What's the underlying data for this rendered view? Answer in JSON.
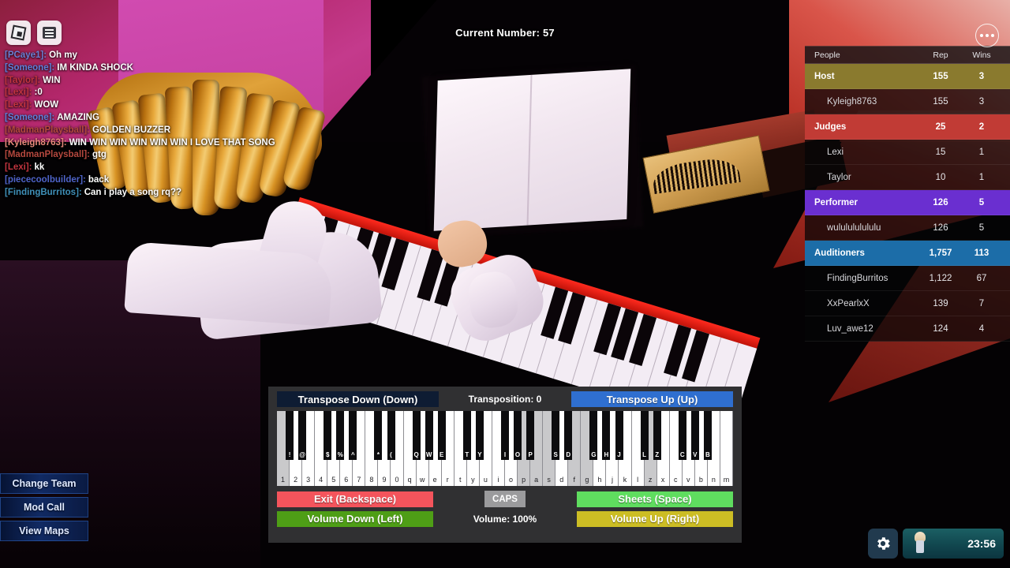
{
  "hud": {
    "roblox_icon": "roblox-logo-icon",
    "chat_icon": "chat-icon",
    "menu_icon": "more-options-icon",
    "current_number_label": "Current Number: 57"
  },
  "chat": {
    "lines": [
      {
        "name": "[PCaye1]:",
        "msg": "Oh my",
        "color": "#6a7fd4"
      },
      {
        "name": "[Someone]:",
        "msg": "IM KINDA SHOCK",
        "color": "#5f7fd8"
      },
      {
        "name": "[Taylor]:",
        "msg": "WIN",
        "color": "#c2343f"
      },
      {
        "name": "[Lexi]:",
        "msg": ":0",
        "color": "#c2343f"
      },
      {
        "name": "[Lexi]:",
        "msg": "WOW",
        "color": "#c2343f"
      },
      {
        "name": "[Someone]:",
        "msg": "AMAZING",
        "color": "#5f7fd8"
      },
      {
        "name": "[MadmanPlaysball]:",
        "msg": "GOLDEN BUZZER",
        "color": "#b5483e"
      },
      {
        "name": "[Kyleigh8763]:",
        "msg": "WIN WIN WIN WIN WIN WIN I LOVE THAT SONG",
        "color": "#e98a7c"
      },
      {
        "name": "[MadmanPlaysball]:",
        "msg": "gtg",
        "color": "#b5483e"
      },
      {
        "name": "[Lexi]:",
        "msg": "kk",
        "color": "#c2343f"
      },
      {
        "name": "[piececoolbuilder]:",
        "msg": "back",
        "color": "#4f63c9"
      },
      {
        "name": "[FindingBurritos]:",
        "msg": "Can i play a song rq??",
        "color": "#3f8fb8"
      }
    ]
  },
  "leaderboard": {
    "columns": {
      "people": "People",
      "rep": "Rep",
      "wins": "Wins"
    },
    "rows": [
      {
        "name": "Host",
        "rep": "155",
        "wins": "3",
        "type": "group",
        "color": "#8a7a2e"
      },
      {
        "name": "Kyleigh8763",
        "rep": "155",
        "wins": "3",
        "type": "member",
        "color": ""
      },
      {
        "name": "Judges",
        "rep": "25",
        "wins": "2",
        "type": "group",
        "color": "#c13b35"
      },
      {
        "name": "Lexi",
        "rep": "15",
        "wins": "1",
        "type": "member",
        "color": ""
      },
      {
        "name": "Taylor",
        "rep": "10",
        "wins": "1",
        "type": "member",
        "color": ""
      },
      {
        "name": "Performer",
        "rep": "126",
        "wins": "5",
        "type": "group",
        "color": "#6a2fd0"
      },
      {
        "name": "wululululululu",
        "rep": "126",
        "wins": "5",
        "type": "member",
        "color": ""
      },
      {
        "name": "Auditioners",
        "rep": "1,757",
        "wins": "113",
        "type": "group",
        "color": "#1c6da8"
      },
      {
        "name": "FindingBurritos",
        "rep": "1,122",
        "wins": "67",
        "type": "member",
        "color": ""
      },
      {
        "name": "XxPearlxX",
        "rep": "139",
        "wins": "7",
        "type": "member",
        "color": ""
      },
      {
        "name": "Luv_awe12",
        "rep": "124",
        "wins": "4",
        "type": "member",
        "color": ""
      }
    ]
  },
  "left_buttons": [
    {
      "label": "Change Team"
    },
    {
      "label": "Mod Call"
    },
    {
      "label": "View Maps"
    }
  ],
  "bottom_right": {
    "gear_icon": "gear-icon",
    "avatar_icon": "avatar-icon",
    "time": "23:56"
  },
  "piano_ui": {
    "transpose_down_label": "Transpose Down (Down)",
    "transposition_label": "Transposition: 0",
    "transpose_up_label": "Transpose Up (Up)",
    "exit_label": "Exit (Backspace)",
    "caps_label": "CAPS",
    "sheets_label": "Sheets (Space)",
    "volume_down_label": "Volume Down (Left)",
    "volume_label": "Volume: 100%",
    "volume_up_label": "Volume Up (Right)",
    "colors": {
      "transpose_down": "#0e1c33",
      "transpose_up": "#2f6fd0",
      "exit": "#f4545c",
      "sheets": "#5fdd5f",
      "volume_down": "#4e9e16",
      "volume_up": "#ccbd24",
      "caps": "#9b9b9d",
      "panel": "#303032"
    },
    "white_keys": [
      "1",
      "2",
      "3",
      "4",
      "5",
      "6",
      "7",
      "8",
      "9",
      "0",
      "q",
      "w",
      "e",
      "r",
      "t",
      "y",
      "u",
      "i",
      "o",
      "p",
      "a",
      "s",
      "d",
      "f",
      "g",
      "h",
      "j",
      "k",
      "l",
      "z",
      "x",
      "c",
      "v",
      "b",
      "n",
      "m"
    ],
    "white_keys_highlighted": [
      "1",
      "p",
      "a",
      "s",
      "f",
      "g",
      "z"
    ],
    "black_keys": [
      {
        "label": "!",
        "after": 0
      },
      {
        "label": "@",
        "after": 1
      },
      {
        "label": "$",
        "after": 3
      },
      {
        "label": "%",
        "after": 4
      },
      {
        "label": "^",
        "after": 5
      },
      {
        "label": "*",
        "after": 7
      },
      {
        "label": "(",
        "after": 8
      },
      {
        "label": "Q",
        "after": 10
      },
      {
        "label": "W",
        "after": 11
      },
      {
        "label": "E",
        "after": 12
      },
      {
        "label": "T",
        "after": 14
      },
      {
        "label": "Y",
        "after": 15
      },
      {
        "label": "I",
        "after": 17
      },
      {
        "label": "O",
        "after": 18
      },
      {
        "label": "P",
        "after": 19
      },
      {
        "label": "S",
        "after": 21
      },
      {
        "label": "D",
        "after": 22
      },
      {
        "label": "G",
        "after": 24
      },
      {
        "label": "H",
        "after": 25
      },
      {
        "label": "J",
        "after": 26
      },
      {
        "label": "L",
        "after": 28
      },
      {
        "label": "Z",
        "after": 29
      },
      {
        "label": "C",
        "after": 31
      },
      {
        "label": "V",
        "after": 32
      },
      {
        "label": "B",
        "after": 33
      }
    ]
  }
}
